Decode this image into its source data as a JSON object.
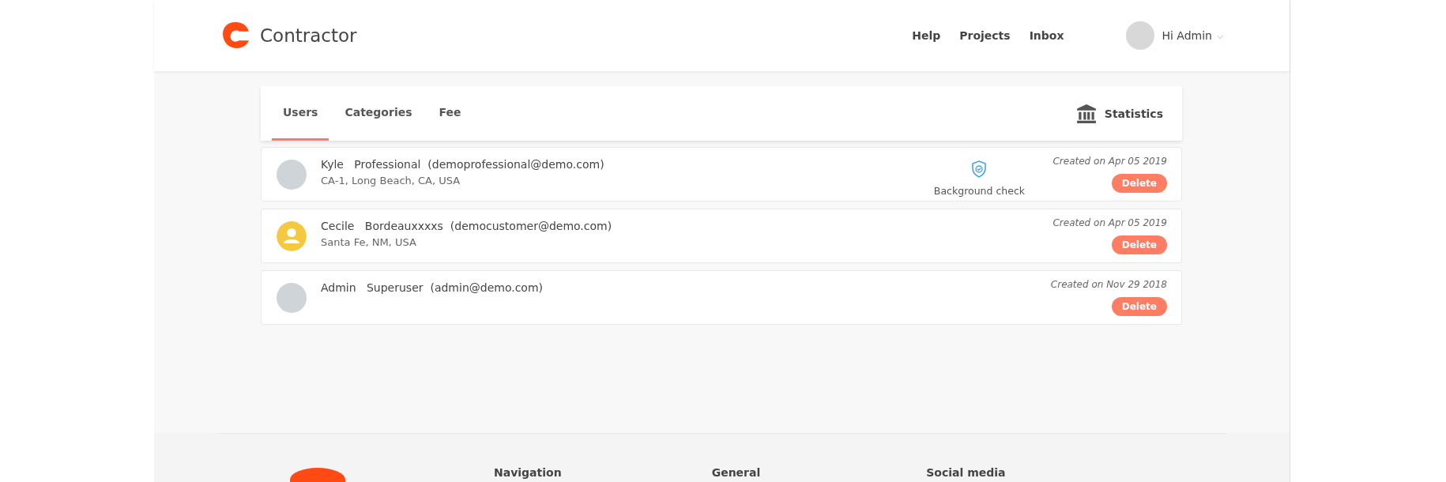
{
  "header": {
    "brand": "Contractor",
    "nav": [
      "Help",
      "Projects",
      "Inbox"
    ],
    "user": {
      "greeting": "Hi Admin",
      "caret": "⌵"
    }
  },
  "tabs": [
    {
      "label": "Users",
      "selected": true
    },
    {
      "label": "Categories",
      "selected": false
    },
    {
      "label": "Fee",
      "selected": false
    }
  ],
  "statistics": "Statistics",
  "users": [
    {
      "first": "Kyle",
      "last": "Professional",
      "email": "(demoprofessional@demo.com)",
      "location": "CA-1, Long Beach, CA, USA",
      "kind": "photo",
      "background_check": "Background check",
      "created": "Created on Apr 05 2019",
      "action": "Delete"
    },
    {
      "first": "Cecile",
      "last": "Bordeauxxxxs",
      "email": "(democustomer@demo.com)",
      "location": "Santa Fe, NM, USA",
      "kind": "default",
      "created": "Created on Apr 05 2019",
      "action": "Delete"
    },
    {
      "first": "Admin",
      "last": "Superuser",
      "email": "(admin@demo.com)",
      "kind": "photo",
      "created": "Created on Nov 29 2018",
      "action": "Delete"
    }
  ],
  "footer": {
    "headings": [
      "Navigation",
      "General",
      "Social media"
    ]
  }
}
